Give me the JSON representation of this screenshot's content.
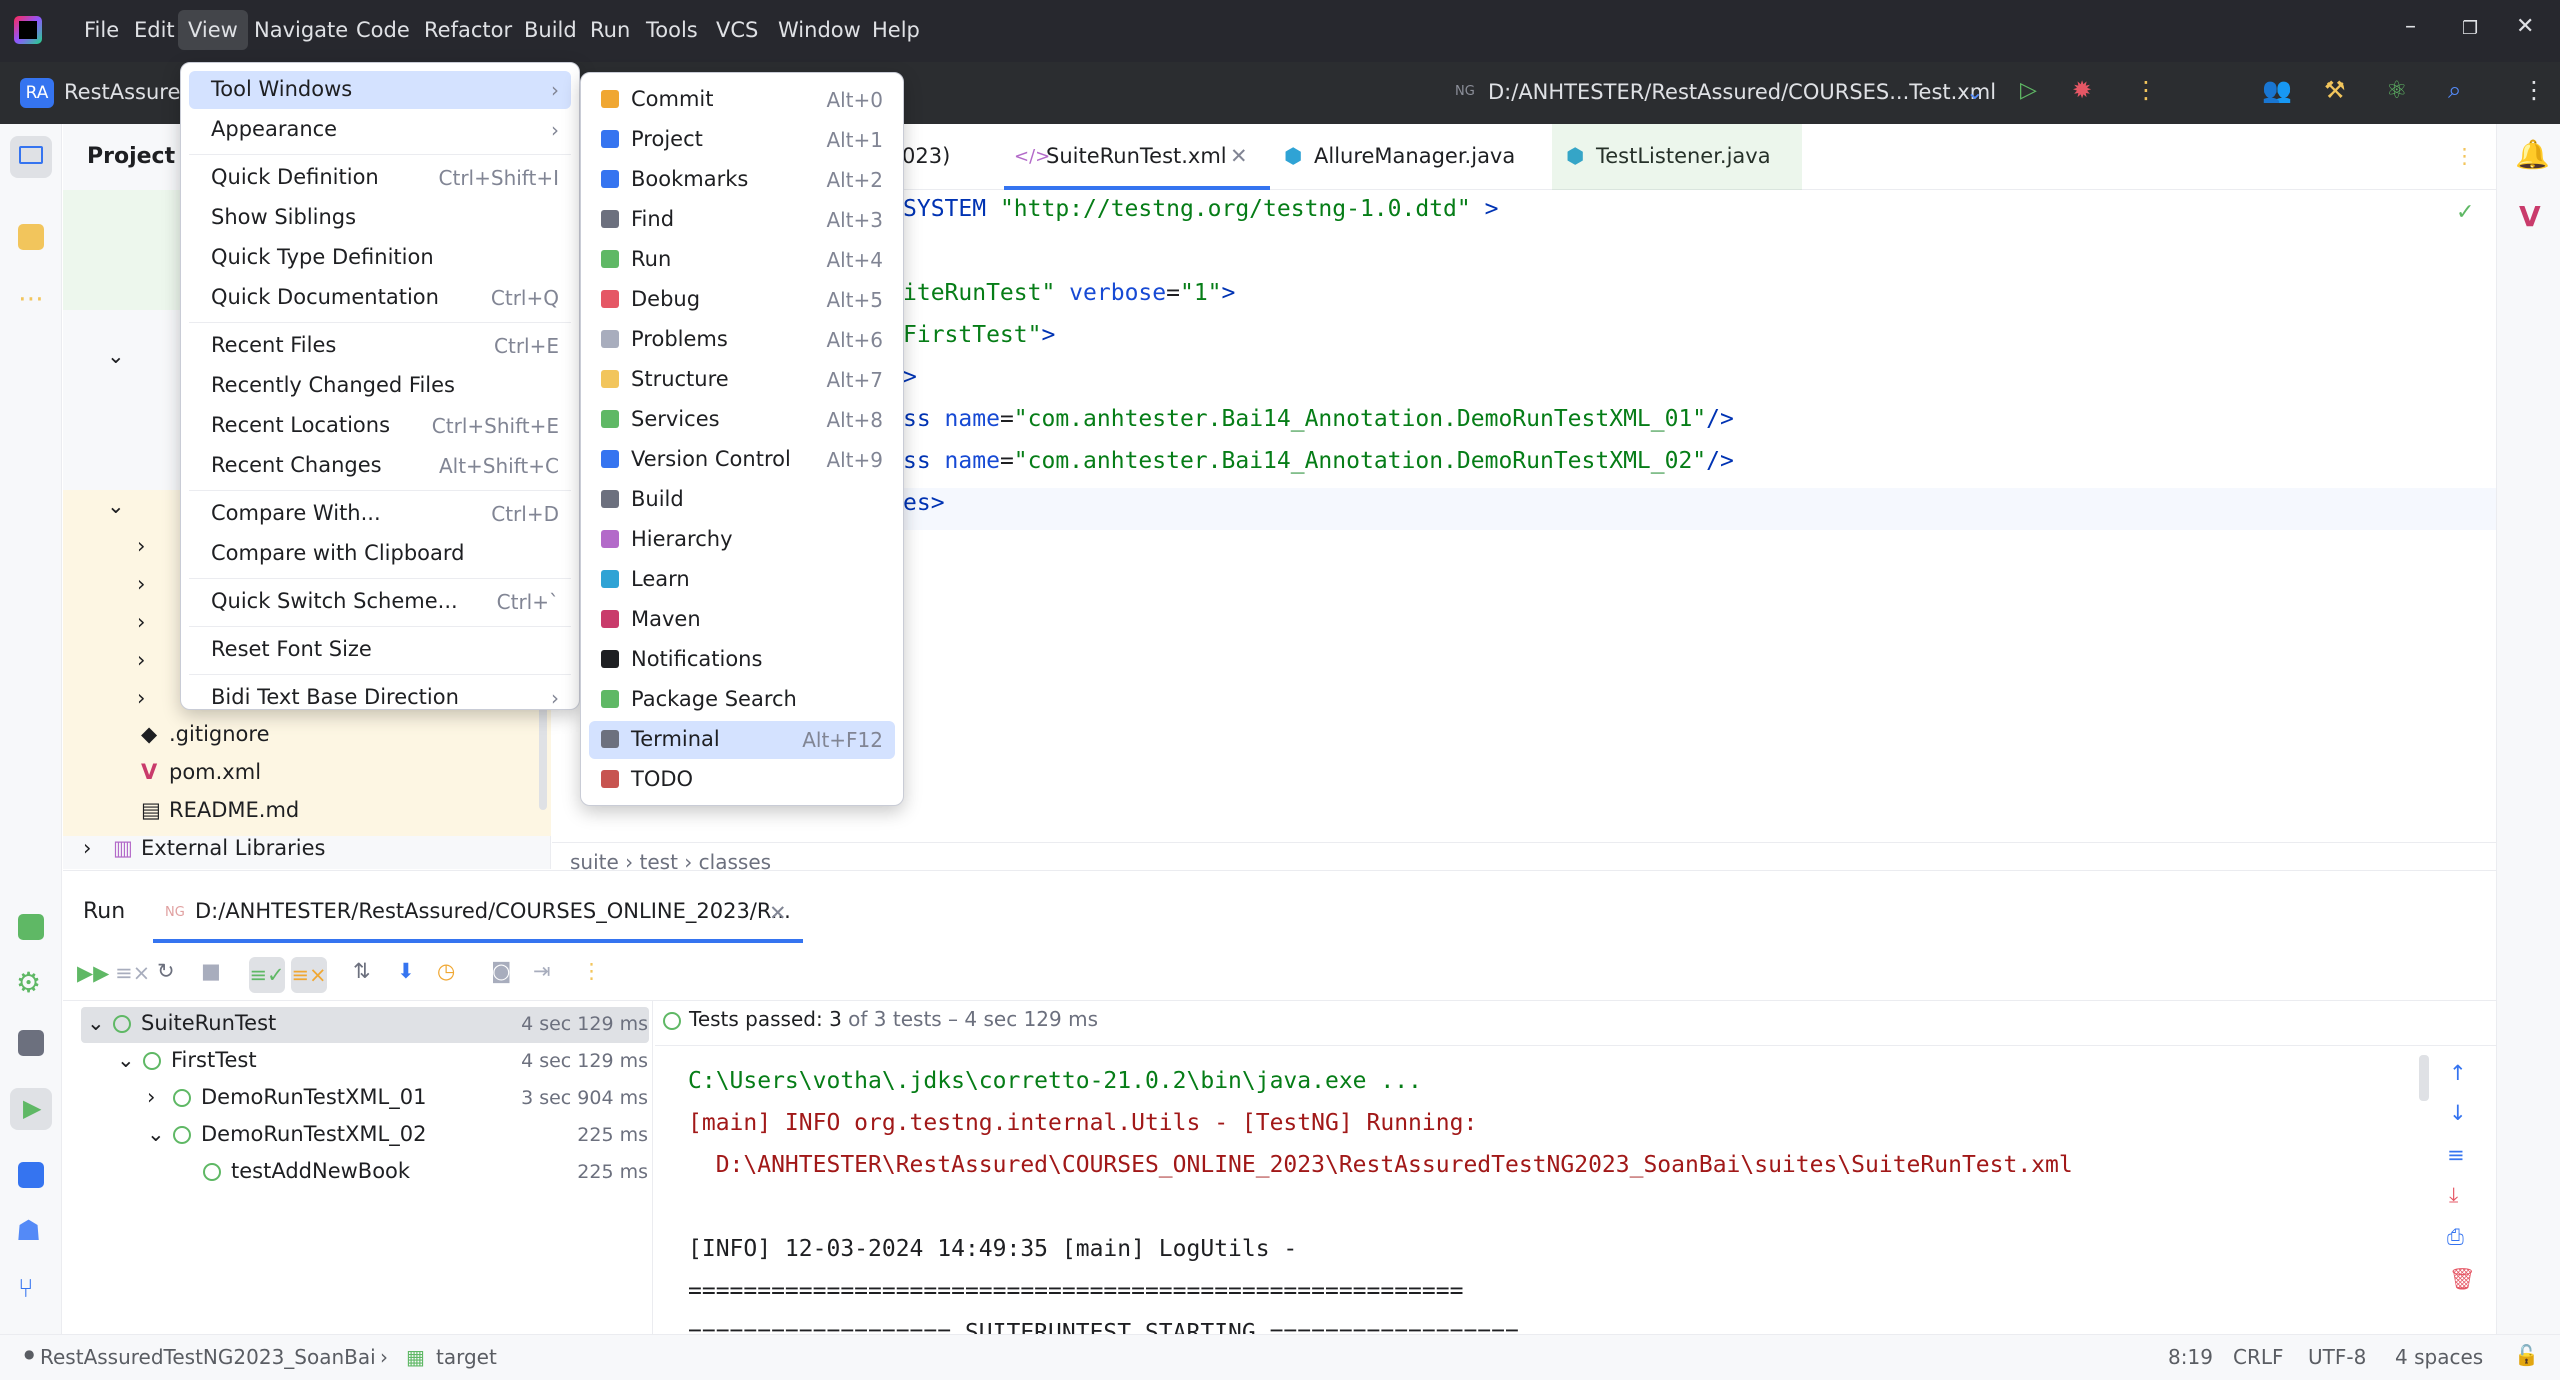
{
  "menubar": {
    "items": [
      "File",
      "Edit",
      "View",
      "Navigate",
      "Code",
      "Refactor",
      "Build",
      "Run",
      "Tools",
      "VCS",
      "Window",
      "Help"
    ],
    "active": "View"
  },
  "toolbar": {
    "project_badge": "RA",
    "project_name": "RestAssured",
    "run_config_path": "D:/ANHTESTER/RestAssured/COURSES...Test.xml"
  },
  "project_panel": {
    "title": "Project",
    "items": [
      ".gitignore",
      "pom.xml",
      "README.md",
      "External Libraries"
    ]
  },
  "tabs": [
    {
      "label": "023)"
    },
    {
      "label": "SuiteRunTest.xml"
    },
    {
      "label": "AllureManager.java"
    },
    {
      "label": "TestListener.java"
    }
  ],
  "editor": {
    "lines": [
      {
        "parts": [
          {
            "t": "SYSTEM ",
            "c": "tagc"
          },
          {
            "t": "\"http://testng.org/testng-1.0.dtd\"",
            "c": "str"
          },
          {
            "t": " >",
            "c": "tagc"
          }
        ]
      },
      {
        "parts": []
      },
      {
        "parts": [
          {
            "t": "iteRunTest\"",
            "c": "str"
          },
          {
            "t": " verbose",
            "c": "attr"
          },
          {
            "t": "=",
            "c": ""
          },
          {
            "t": "\"1\"",
            "c": "str"
          },
          {
            "t": ">",
            "c": "tagc"
          }
        ]
      },
      {
        "parts": [
          {
            "t": "FirstTest\"",
            "c": "str"
          },
          {
            "t": ">",
            "c": "tagc"
          }
        ]
      },
      {
        "parts": [
          {
            "t": ">",
            "c": "tagc"
          }
        ]
      },
      {
        "parts": [
          {
            "t": "ss ",
            "c": "tagc"
          },
          {
            "t": "name",
            "c": "attr"
          },
          {
            "t": "=",
            "c": ""
          },
          {
            "t": "\"com.anhtester.Bai14_Annotation.DemoRunTestXML_01\"",
            "c": "str"
          },
          {
            "t": "/>",
            "c": "tagc"
          }
        ]
      },
      {
        "parts": [
          {
            "t": "ss ",
            "c": "tagc"
          },
          {
            "t": "name",
            "c": "attr"
          },
          {
            "t": "=",
            "c": ""
          },
          {
            "t": "\"com.anhtester.Bai14_Annotation.DemoRunTestXML_02\"",
            "c": "str"
          },
          {
            "t": "/>",
            "c": "tagc"
          }
        ]
      },
      {
        "parts": [
          {
            "t": "es>",
            "c": "tagc"
          }
        ]
      }
    ],
    "breadcrumb": [
      "suite",
      "test",
      "classes"
    ]
  },
  "view_menu": {
    "items": [
      {
        "label": "Tool Windows",
        "shortcut": "",
        "submenu": true,
        "selected": true
      },
      {
        "label": "Appearance",
        "shortcut": "",
        "submenu": true
      },
      {
        "sep": true
      },
      {
        "label": "Quick Definition",
        "shortcut": "Ctrl+Shift+I"
      },
      {
        "label": "Show Siblings",
        "shortcut": ""
      },
      {
        "label": "Quick Type Definition",
        "shortcut": ""
      },
      {
        "label": "Quick Documentation",
        "shortcut": "Ctrl+Q"
      },
      {
        "sep": true
      },
      {
        "label": "Recent Files",
        "shortcut": "Ctrl+E"
      },
      {
        "label": "Recently Changed Files",
        "shortcut": ""
      },
      {
        "label": "Recent Locations",
        "shortcut": "Ctrl+Shift+E"
      },
      {
        "label": "Recent Changes",
        "shortcut": "Alt+Shift+C"
      },
      {
        "sep": true
      },
      {
        "label": "Compare With...",
        "shortcut": "Ctrl+D"
      },
      {
        "label": "Compare with Clipboard",
        "shortcut": ""
      },
      {
        "sep": true
      },
      {
        "label": "Quick Switch Scheme...",
        "shortcut": "Ctrl+`"
      },
      {
        "sep": true
      },
      {
        "label": "Reset Font Size",
        "shortcut": ""
      },
      {
        "sep": true
      },
      {
        "label": "Bidi Text Base Direction",
        "shortcut": "",
        "submenu": true
      }
    ]
  },
  "tool_windows_menu": {
    "items": [
      {
        "label": "Commit",
        "shortcut": "Alt+0",
        "color": "#f0a732"
      },
      {
        "label": "Project",
        "shortcut": "Alt+1",
        "color": "#3574f0"
      },
      {
        "label": "Bookmarks",
        "shortcut": "Alt+2",
        "color": "#3574f0"
      },
      {
        "label": "Find",
        "shortcut": "Alt+3",
        "color": "#6c707e"
      },
      {
        "label": "Run",
        "shortcut": "Alt+4",
        "color": "#5fb865"
      },
      {
        "label": "Debug",
        "shortcut": "Alt+5",
        "color": "#e55765"
      },
      {
        "label": "Problems",
        "shortcut": "Alt+6",
        "color": "#a8adbd"
      },
      {
        "label": "Structure",
        "shortcut": "Alt+7",
        "color": "#f2c55c"
      },
      {
        "label": "Services",
        "shortcut": "Alt+8",
        "color": "#5fb865"
      },
      {
        "label": "Version Control",
        "shortcut": "Alt+9",
        "color": "#3574f0"
      },
      {
        "label": "Build",
        "shortcut": "",
        "color": "#6c707e"
      },
      {
        "label": "Hierarchy",
        "shortcut": "",
        "color": "#b36ac9"
      },
      {
        "label": "Learn",
        "shortcut": "",
        "color": "#2fa3d5"
      },
      {
        "label": "Maven",
        "shortcut": "",
        "color": "#c93b6b"
      },
      {
        "label": "Notifications",
        "shortcut": "",
        "color": "#1e1f22"
      },
      {
        "label": "Package Search",
        "shortcut": "",
        "color": "#5fb865"
      },
      {
        "label": "Terminal",
        "shortcut": "Alt+F12",
        "color": "#6c707e",
        "selected": true
      },
      {
        "label": "TODO",
        "shortcut": "",
        "color": "#c75450"
      }
    ]
  },
  "run_panel": {
    "title": "Run",
    "tab_label": "D:/ANHTESTER/RestAssured/COURSES_ONLINE_2023/R...",
    "tree": [
      {
        "label": "SuiteRunTest",
        "time": "4 sec 129 ms",
        "indent": 0,
        "arrow": "⌄"
      },
      {
        "label": "FirstTest",
        "time": "4 sec 129 ms",
        "indent": 1,
        "arrow": "⌄"
      },
      {
        "label": "DemoRunTestXML_01",
        "time": "3 sec 904 ms",
        "indent": 2,
        "arrow": "›"
      },
      {
        "label": "DemoRunTestXML_02",
        "time": "225 ms",
        "indent": 2,
        "arrow": "⌄"
      },
      {
        "label": "testAddNewBook",
        "time": "225 ms",
        "indent": 3,
        "arrow": ""
      }
    ],
    "status_prefix": "Tests passed: ",
    "status_count": "3",
    "status_suffix": " of 3 tests – 4 sec 129 ms",
    "console": [
      {
        "text": "C:\\Users\\votha\\.jdks\\corretto-21.0.2\\bin\\java.exe ...",
        "color": "#067d17"
      },
      {
        "text": "[main] INFO org.testng.internal.Utils - [TestNG] Running:",
        "color": "#a11818"
      },
      {
        "text": "  D:\\ANHTESTER\\RestAssured\\COURSES_ONLINE_2023\\RestAssuredTestNG2023_SoanBai\\suites\\SuiteRunTest.xml",
        "color": "#a11818"
      },
      {
        "text": "",
        "color": "#1e1f22"
      },
      {
        "text": "[INFO] 12-03-2024 14:49:35 [main] LogUtils -",
        "color": "#1e1f22"
      },
      {
        "text": "========================================================",
        "color": "#1e1f22"
      },
      {
        "text": "=================== SUITERUNTEST STARTING ==================",
        "color": "#1e1f22"
      }
    ]
  },
  "statusbar": {
    "breadcrumb": [
      "RestAssuredTestNG2023_SoanBai",
      "target"
    ],
    "position": "8:19",
    "line_sep": "CRLF",
    "encoding": "UTF-8",
    "indent": "4 spaces"
  }
}
